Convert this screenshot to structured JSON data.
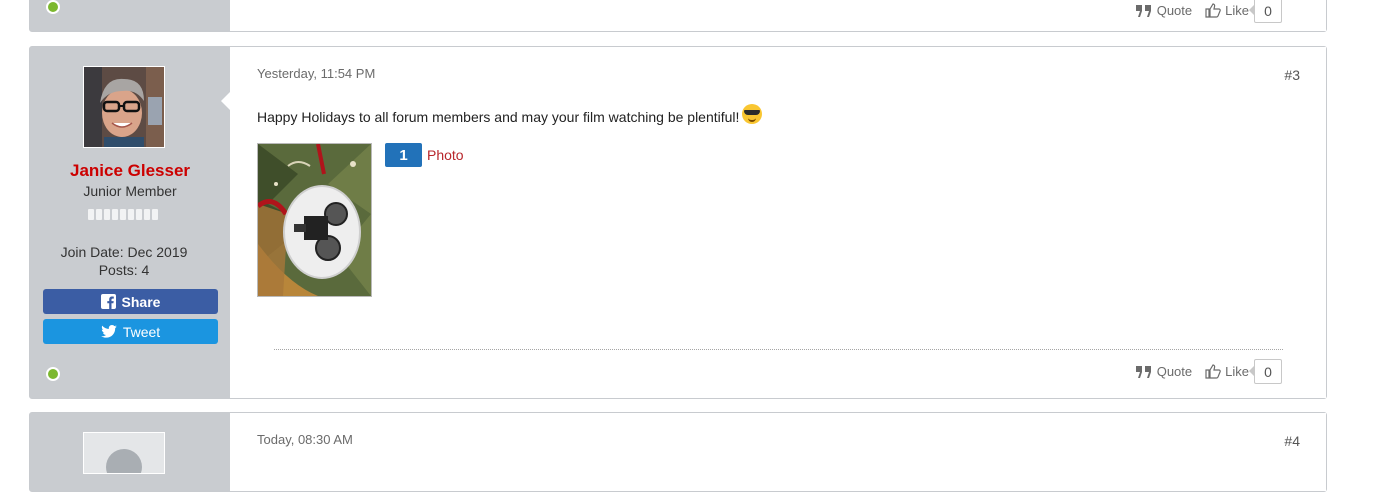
{
  "prev_post": {
    "actions": {
      "quote_label": "Quote",
      "like_label": "Like",
      "like_count": "0"
    }
  },
  "post3": {
    "timestamp": "Yesterday, 11:54 PM",
    "post_number": "#3",
    "author": {
      "name": "Janice Glesser",
      "rank": "Junior Member",
      "join_date": "Join Date: Dec 2019",
      "posts": "Posts: 4",
      "share_label": "Share",
      "tweet_label": "Tweet"
    },
    "text": "Happy Holidays to all forum members and may your film watching be plentiful!",
    "emoji_icon": "sunglasses-emoji",
    "photo_count": "1",
    "photo_label": "Photo",
    "actions": {
      "quote_label": "Quote",
      "like_label": "Like",
      "like_count": "0"
    }
  },
  "post4": {
    "timestamp": "Today, 08:30 AM",
    "post_number": "#4"
  },
  "colors": {
    "username": "#cc0000",
    "online": "#7cb82f",
    "facebook": "#3b5da4",
    "twitter": "#1b95e0",
    "photo_badge": "#2272b9",
    "photo_link": "#b8262b"
  }
}
